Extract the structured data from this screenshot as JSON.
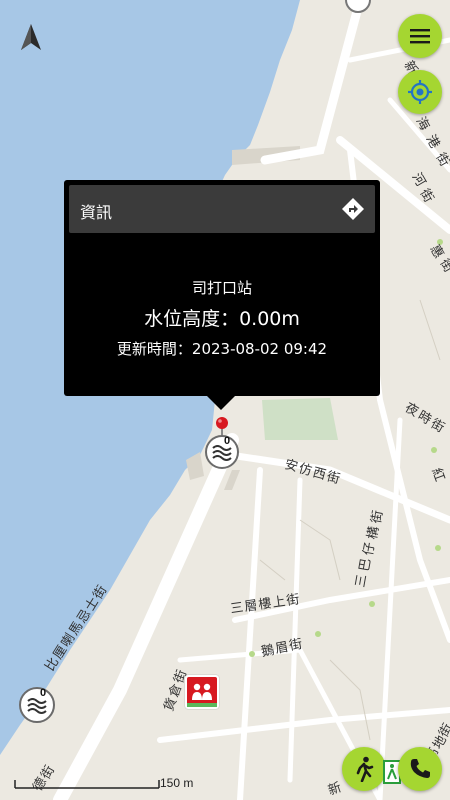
{
  "popup": {
    "header_title": "資訊",
    "station_name": "司打口站",
    "water_level": "水位高度：0.00m",
    "updated_time": "更新時間：2023-08-02 09:42"
  },
  "map": {
    "street_labels": [
      "新",
      "海",
      "港",
      "街",
      "河",
      "街",
      "惠",
      "街",
      "夜",
      "時",
      "街",
      "安",
      "仿",
      "西",
      "街",
      "紅",
      "三",
      "巴",
      "仔",
      "構",
      "街",
      "三",
      "層",
      "樓",
      "上",
      "街",
      "鵝",
      "眉",
      "街",
      "比",
      "厘",
      "喇",
      "馬",
      "忌",
      "士",
      "街",
      "貨",
      "倉",
      "街",
      "德",
      "街",
      "高",
      "地",
      "街",
      "新"
    ],
    "scale_label": "150 m",
    "station_badge_count": "0",
    "lower_station_badge_count": "0"
  },
  "buttons": {
    "menu": "menu-icon",
    "locate": "locate-icon",
    "walk": "walk-icon",
    "phone": "phone-icon",
    "navigate": "navigate-icon"
  },
  "colors": {
    "water": "#a7c7e6",
    "land": "#ece9e1",
    "road": "#ffffff",
    "fab": "#a5d631",
    "popup_bg": "#000000",
    "popup_header": "#3b3b3b",
    "marker": "#d71920"
  }
}
